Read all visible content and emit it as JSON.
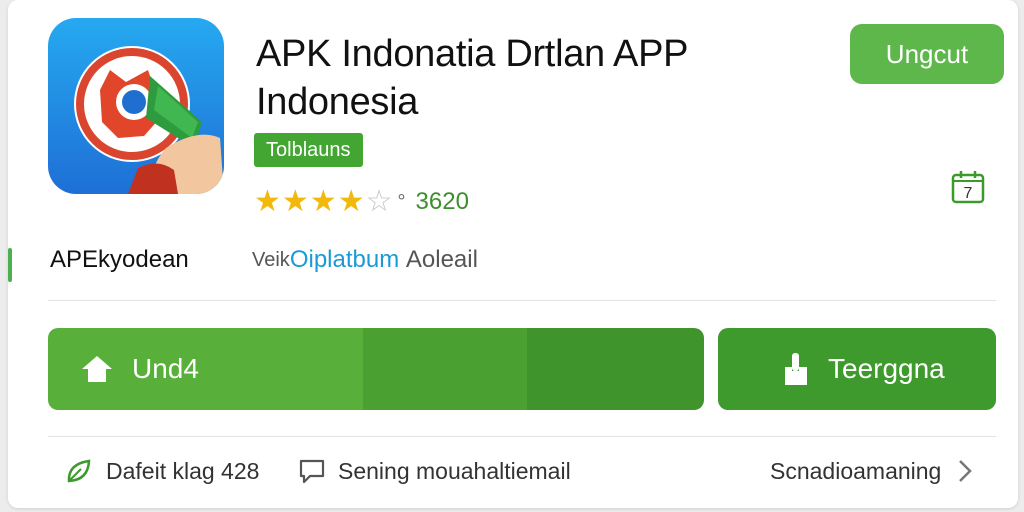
{
  "app": {
    "title": "APK Indonatia Drtlan APP Indonesia",
    "badge": "Tolblauns",
    "rating_stars": 4,
    "rating_max": 5,
    "rating_count": "3620",
    "developer": "APEkyodean",
    "platform_prefix": "Veik",
    "platform_accent": "Oiplatbum",
    "platform_suffix": "Aoleail"
  },
  "header": {
    "action_label": "Ungcut",
    "calendar_badge": "7"
  },
  "actions": {
    "install_label": "Und4",
    "secondary_label": "Teerggna"
  },
  "footer": {
    "item1": "Dafeit klag 428",
    "item2": "Sening mouahaltiemail",
    "item3": "Scnadioamaning"
  },
  "colors": {
    "primary_green": "#4aa131",
    "button_green": "#5eb74a",
    "star": "#f2b90c",
    "accent_blue": "#1a9bd8",
    "icon_blue": "#1e6fd6"
  },
  "icons": {
    "app_logo": "red-mascot-holding-green-banknote",
    "install": "home-upload-icon",
    "secondary": "hand-touch-icon",
    "calendar": "calendar-icon",
    "footer1": "leaf-icon",
    "footer2": "chat-bubble-icon",
    "footer3": "chevron-right-icon"
  }
}
